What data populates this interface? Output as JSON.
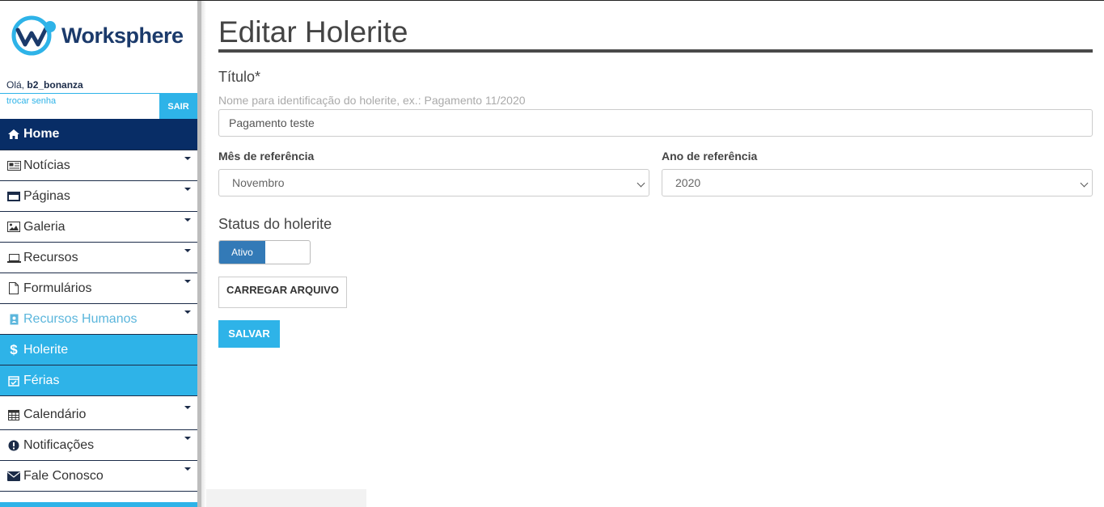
{
  "brand": {
    "name": "Worksphere"
  },
  "user": {
    "greeting": "Olá,",
    "username": "b2_bonanza",
    "change_password": "trocar senha",
    "logout": "SAIR"
  },
  "nav": {
    "home": "Home",
    "items": [
      {
        "label": "Notícias",
        "icon": "newspaper-icon"
      },
      {
        "label": "Páginas",
        "icon": "window-icon"
      },
      {
        "label": "Galeria",
        "icon": "image-icon"
      },
      {
        "label": "Recursos",
        "icon": "laptop-icon"
      },
      {
        "label": "Formulários",
        "icon": "file-icon"
      },
      {
        "label": "Recursos Humanos",
        "icon": "badge-icon"
      }
    ],
    "sub": [
      {
        "label": "Holerite",
        "icon": "dollar-icon"
      },
      {
        "label": "Férias",
        "icon": "calendar-check-icon"
      }
    ],
    "after": [
      {
        "label": "Calendário",
        "icon": "calendar-icon"
      },
      {
        "label": "Notificações",
        "icon": "alert-icon"
      },
      {
        "label": "Fale Conosco",
        "icon": "envelope-icon"
      }
    ]
  },
  "page": {
    "title": "Editar Holerite"
  },
  "form": {
    "title_label": "Título*",
    "title_help": "Nome para identificação do holerite, ex.: Pagamento 11/2020",
    "title_value": "Pagamento teste",
    "month_label": "Mês de referência",
    "month_value": "Novembro",
    "year_label": "Ano de referência",
    "year_value": "2020",
    "status_label": "Status do holerite",
    "status_value": "Ativo",
    "upload_label": "CARREGAR ARQUIVO",
    "save_label": "SALVAR"
  },
  "colors": {
    "navy": "#082d66",
    "accent": "#2eb3e8",
    "toggle": "#337ab7"
  }
}
